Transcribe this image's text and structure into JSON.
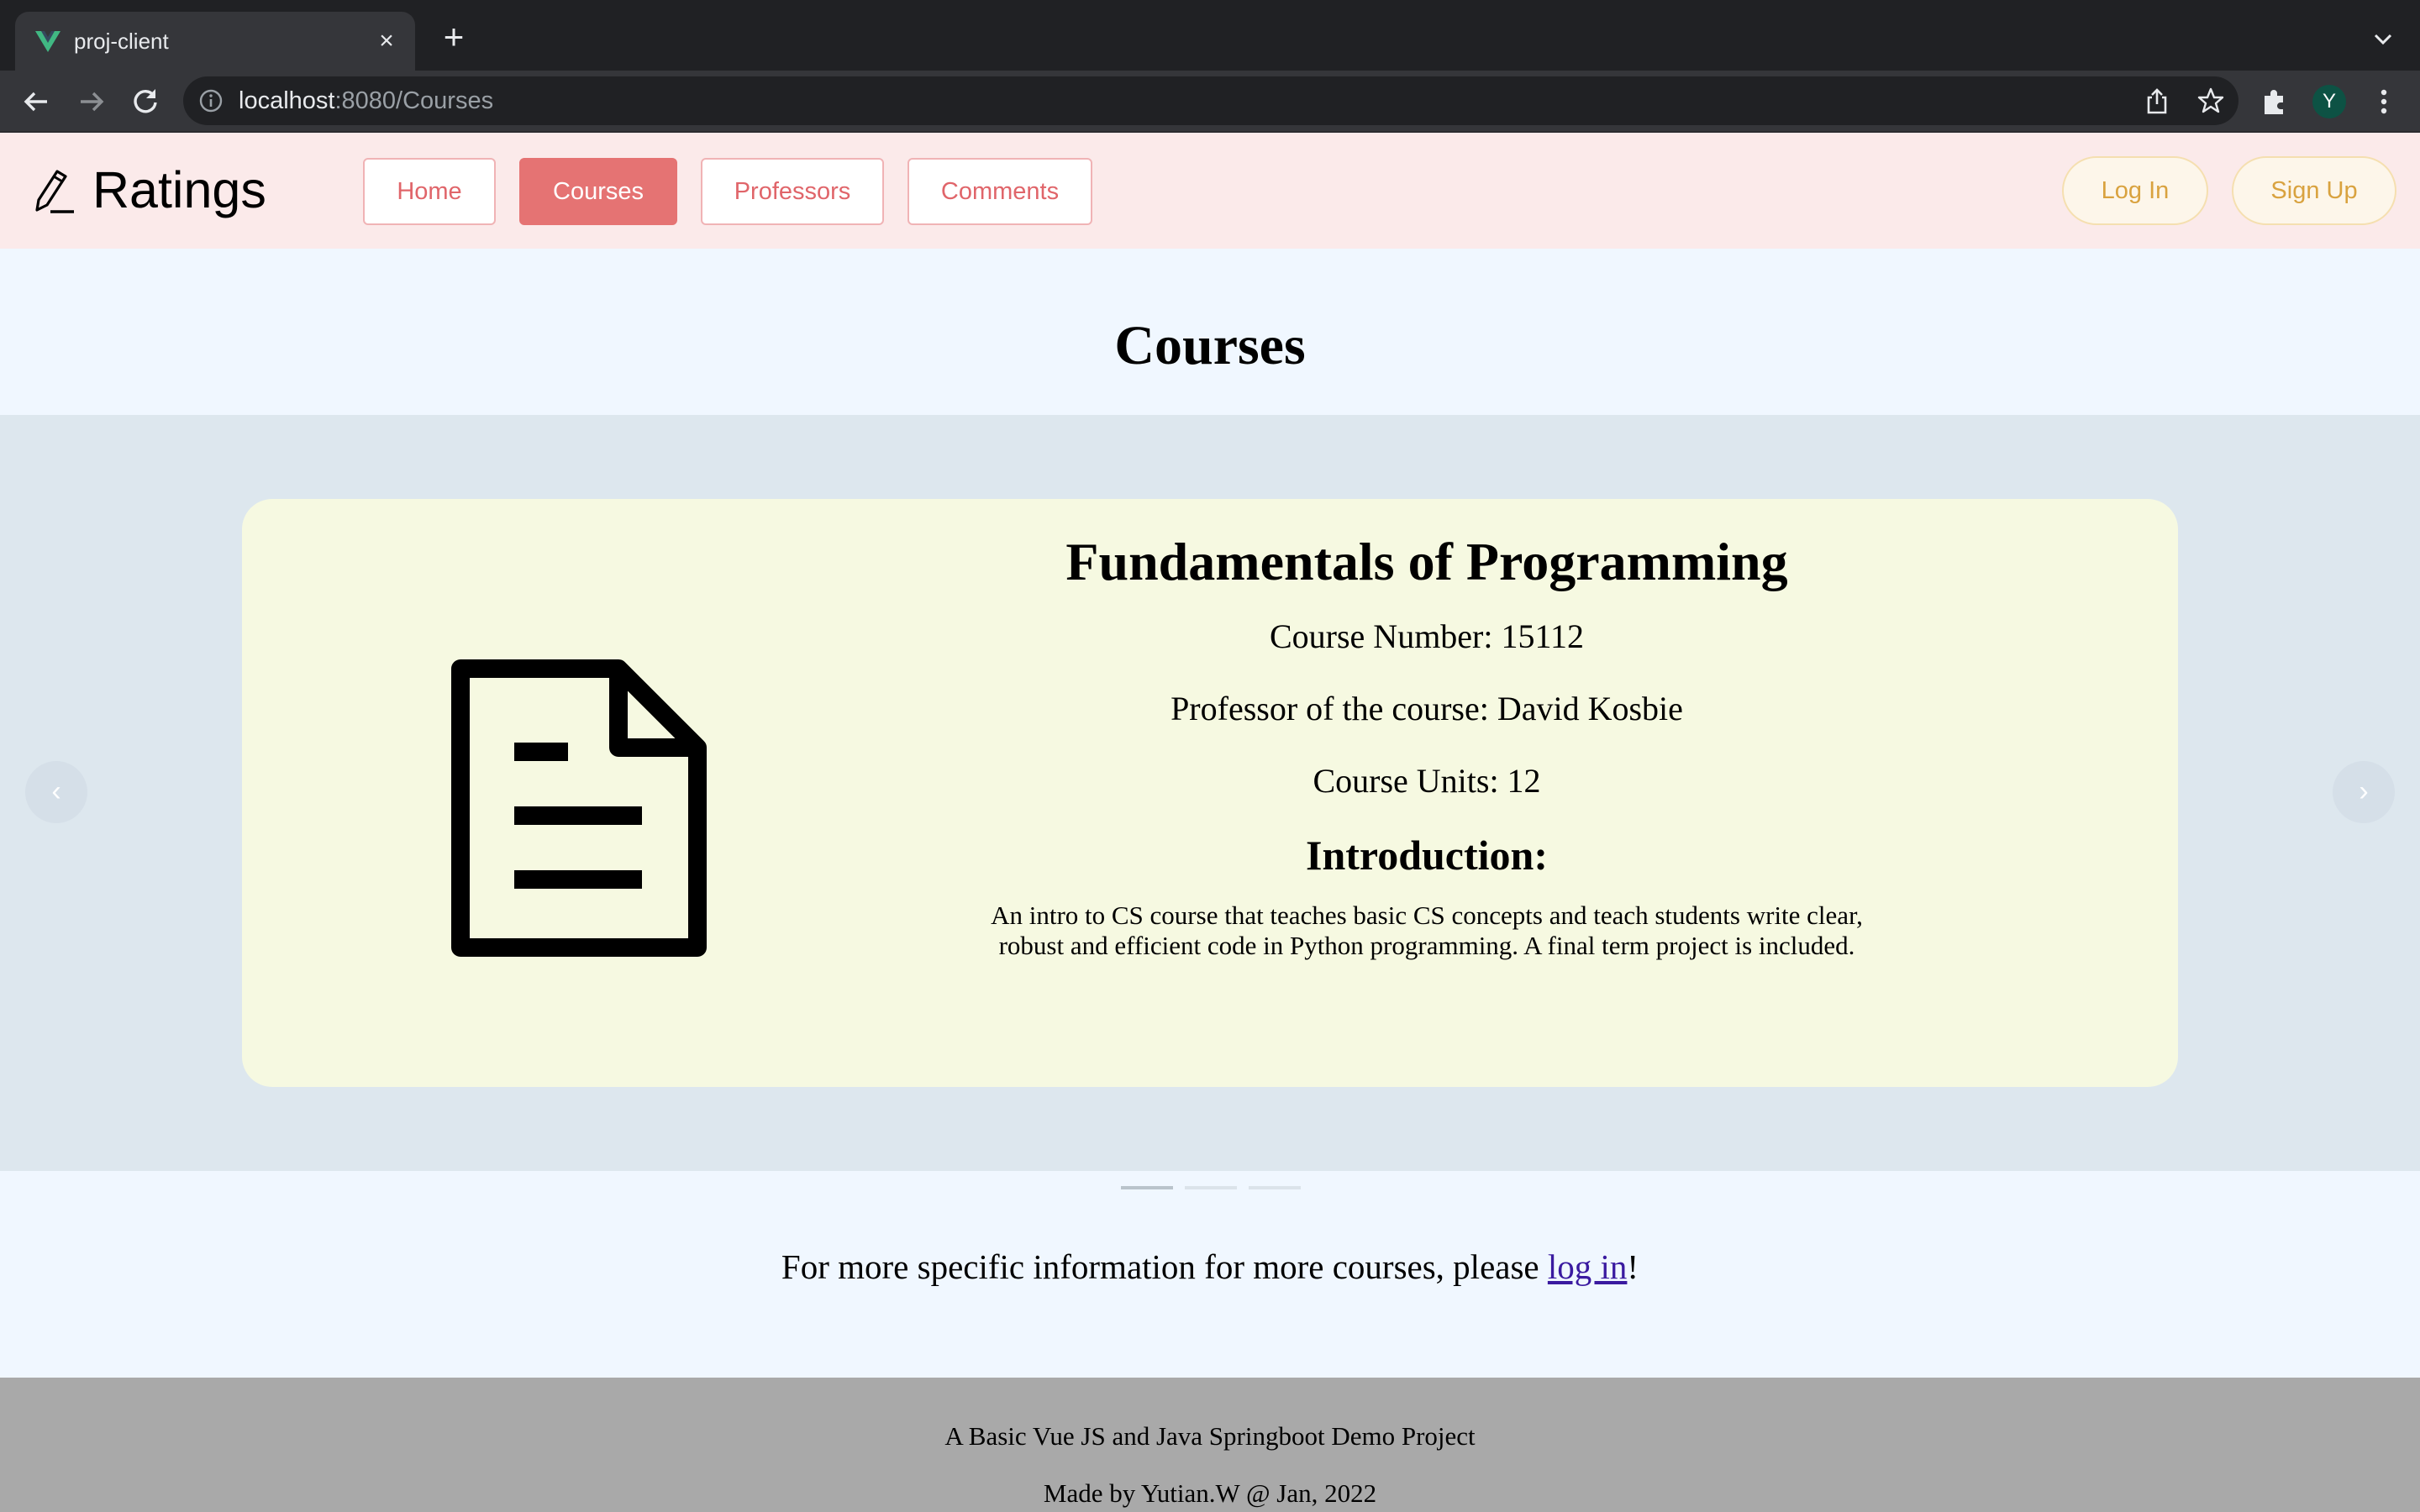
{
  "browser": {
    "tab_title": "proj-client",
    "tab_close": "×",
    "new_tab": "+",
    "url_host": "localhost",
    "url_path": ":8080/Courses",
    "profile_initial": "Y"
  },
  "header": {
    "brand": "Ratings",
    "nav": [
      {
        "label": "Home",
        "active": false
      },
      {
        "label": "Courses",
        "active": true
      },
      {
        "label": "Professors",
        "active": false
      },
      {
        "label": "Comments",
        "active": false
      }
    ],
    "login_label": "Log In",
    "signup_label": "Sign Up"
  },
  "main": {
    "title": "Courses",
    "course": {
      "name": "Fundamentals of Programming",
      "number_line": "Course Number: 15112",
      "professor_line": "Professor of the course: David Kosbie",
      "units_line": "Course Units: 12",
      "intro_heading": "Introduction:",
      "intro_text": "An intro to CS course that teaches basic CS concepts and teach students write clear, robust and efficient code in Python programming. A final term project is included."
    },
    "carousel": {
      "prev": "‹",
      "next": "›",
      "slide_count": 3,
      "active_index": 0
    },
    "more_info_prefix": "For more specific information for more courses, please ",
    "more_info_link": "log in",
    "more_info_suffix": "!"
  },
  "footer": {
    "line1": "A Basic Vue JS and Java Springboot Demo Project",
    "line2": "Made by Yutian.W @ Jan, 2022"
  },
  "colors": {
    "header_bg": "#fbeaea",
    "nav_active": "#e57373",
    "card_bg": "#f6f9e1",
    "carousel_bg": "#dde7ee",
    "footer_bg": "#a9a9a9"
  }
}
